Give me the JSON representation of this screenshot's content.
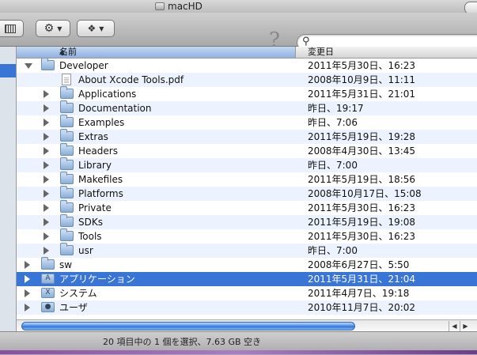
{
  "window": {
    "title": "macHD"
  },
  "toolbar": {
    "help_symbol": "?",
    "search_placeholder": ""
  },
  "columns": {
    "name": "名前",
    "date": "変更日"
  },
  "rows": [
    {
      "name": "Developer",
      "date": "2011年5月30日、16:23",
      "kind": "folder",
      "level": 0,
      "disclosure": "open"
    },
    {
      "name": "About Xcode Tools.pdf",
      "date": "2008年10月9日、11:11",
      "kind": "document",
      "level": 1,
      "disclosure": "none"
    },
    {
      "name": "Applications",
      "date": "2011年5月31日、21:01",
      "kind": "folder",
      "level": 1,
      "disclosure": "closed"
    },
    {
      "name": "Documentation",
      "date": "昨日、19:17",
      "kind": "folder",
      "level": 1,
      "disclosure": "closed"
    },
    {
      "name": "Examples",
      "date": "昨日、7:06",
      "kind": "folder",
      "level": 1,
      "disclosure": "closed"
    },
    {
      "name": "Extras",
      "date": "2011年5月19日、19:28",
      "kind": "folder",
      "level": 1,
      "disclosure": "closed"
    },
    {
      "name": "Headers",
      "date": "2008年4月30日、13:45",
      "kind": "folder",
      "level": 1,
      "disclosure": "closed"
    },
    {
      "name": "Library",
      "date": "昨日、7:00",
      "kind": "folder",
      "level": 1,
      "disclosure": "closed"
    },
    {
      "name": "Makefiles",
      "date": "2011年5月19日、18:56",
      "kind": "folder",
      "level": 1,
      "disclosure": "closed"
    },
    {
      "name": "Platforms",
      "date": "2008年10月17日、15:08",
      "kind": "folder",
      "level": 1,
      "disclosure": "closed"
    },
    {
      "name": "Private",
      "date": "2011年5月30日、16:23",
      "kind": "folder",
      "level": 1,
      "disclosure": "closed"
    },
    {
      "name": "SDKs",
      "date": "2011年5月19日、19:08",
      "kind": "folder",
      "level": 1,
      "disclosure": "closed"
    },
    {
      "name": "Tools",
      "date": "2011年5月30日、16:23",
      "kind": "folder",
      "level": 1,
      "disclosure": "closed"
    },
    {
      "name": "usr",
      "date": "昨日、7:00",
      "kind": "folder",
      "level": 1,
      "disclosure": "closed"
    },
    {
      "name": "sw",
      "date": "2008年6月27日、5:50",
      "kind": "folder",
      "level": 0,
      "disclosure": "closed"
    },
    {
      "name": "アプリケーション",
      "date": "2011年5月31日、21:04",
      "kind": "app-folder",
      "level": 0,
      "disclosure": "closed",
      "selected": true
    },
    {
      "name": "システム",
      "date": "2011年4月7日、19:18",
      "kind": "system-folder",
      "level": 0,
      "disclosure": "closed"
    },
    {
      "name": "ユーザ",
      "date": "2010年11月7日、20:02",
      "kind": "users-folder",
      "level": 0,
      "disclosure": "closed"
    }
  ],
  "status": {
    "text": "20 項目中の 1 個を選択、7.63 GB 空き"
  },
  "colors": {
    "selection": "#3875d7",
    "alt_row": "#edf3fe"
  }
}
